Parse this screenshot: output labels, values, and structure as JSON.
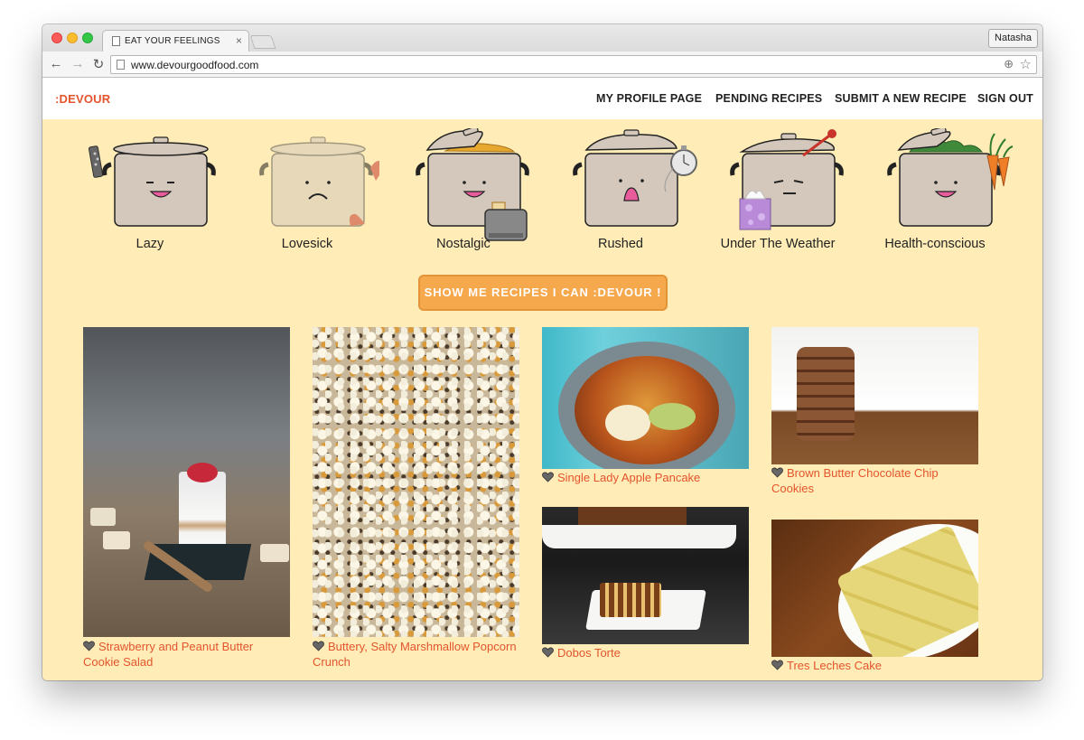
{
  "browser": {
    "tab_title": "EAT YOUR FEELINGS",
    "tab_close": "×",
    "profile_name": "Natasha",
    "url": "www.devourgoodfood.com",
    "back": "←",
    "forward": "→",
    "reload": "↻",
    "zoom": "⊕",
    "star": "☆"
  },
  "site": {
    "logo": ":DEVOUR",
    "nav": [
      "MY PROFILE PAGE",
      "PENDING RECIPES",
      "SUBMIT A NEW RECIPE",
      "SIGN OUT"
    ],
    "moods": [
      {
        "label": "Lazy",
        "icon": "pot-with-remote-icon"
      },
      {
        "label": "Lovesick",
        "icon": "pot-with-broken-heart-icon"
      },
      {
        "label": "Nostalgic",
        "icon": "pot-with-toaster-icon"
      },
      {
        "label": "Rushed",
        "icon": "pot-with-stopwatch-icon"
      },
      {
        "label": "Under The Weather",
        "icon": "pot-with-thermometer-icon"
      },
      {
        "label": "Health-conscious",
        "icon": "pot-with-carrots-icon"
      }
    ],
    "cta": "SHOW ME RECIPES I CAN :DEVOUR !",
    "recipes": [
      {
        "title": "Strawberry and Peanut Butter Cookie Salad",
        "line1": "Strawberry and Peanut Butter",
        "line2": "Cookie Salad"
      },
      {
        "title": "Buttery, Salty Marshmallow Popcorn Crunch",
        "line1": "Buttery, Salty Marshmallow Popcorn",
        "line2": "Crunch"
      },
      {
        "title": "Single Lady Apple Pancake",
        "line1": "Single Lady Apple Pancake",
        "line2": ""
      },
      {
        "title": "Brown Butter Chocolate Chip Cookies",
        "line1": "Brown Butter Chocolate Chip",
        "line2": "Cookies"
      },
      {
        "title": "Dobos Torte",
        "line1": "Dobos Torte",
        "line2": ""
      },
      {
        "title": "Tres Leches Cake",
        "line1": "Tres Leches Cake",
        "line2": ""
      }
    ],
    "colors": {
      "background": "#ffecb6",
      "accent": "#e4542e",
      "button": "#f6a84c"
    }
  }
}
